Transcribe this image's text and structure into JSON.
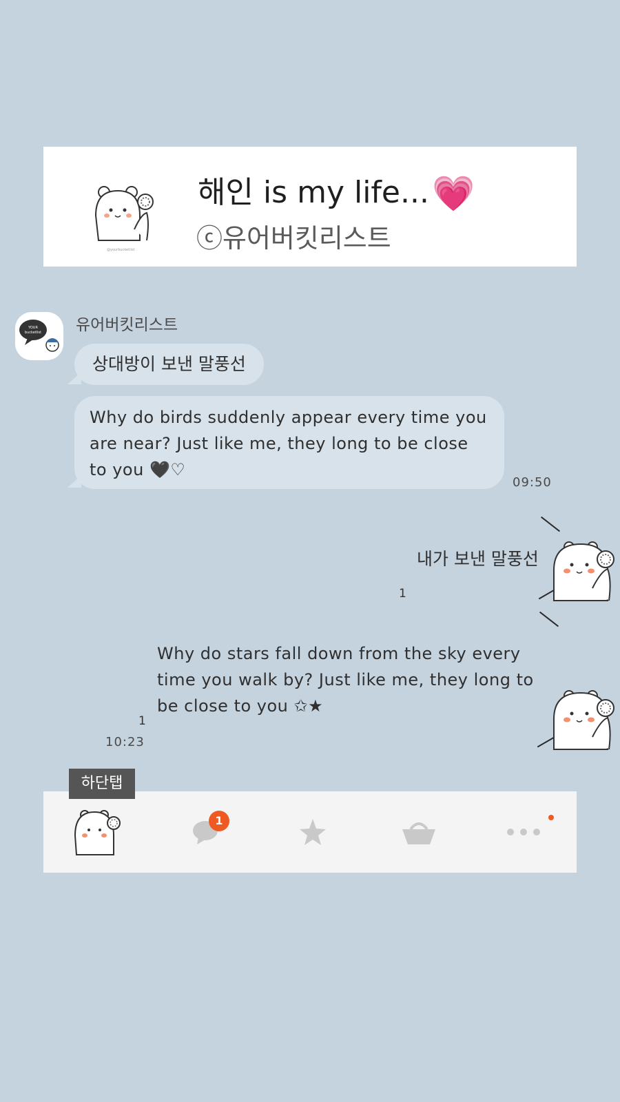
{
  "banner": {
    "title": "해인 is my life...",
    "heart_icon": "💗",
    "subtitle": "ⓒ유어버킷리스트",
    "tiny_credit": "@yourbucketlist"
  },
  "profile": {
    "name": "유어버킷리스트",
    "avatar_text_1": "YOUR",
    "avatar_text_2": "bucketlist"
  },
  "received": {
    "bubble_1": "상대방이 보낸 말풍선",
    "bubble_2": "Why do birds suddenly appear every time you are near? Just like me, they long to be close to you 🖤♡",
    "time": "09:50"
  },
  "sent": {
    "message_1": "내가 보낸 말풍선",
    "read_count_1": "1",
    "message_2": "Why do stars fall down from the sky every time you walk by? Just like me, they long to be close to you ✩★",
    "read_count_2": "1",
    "time": "10:23"
  },
  "bottom_tab": {
    "label": "하단탭",
    "badge_count": "1",
    "icons": [
      "bear-profile-icon",
      "chat-bubble-icon",
      "star-icon",
      "shopping-basket-icon",
      "more-dots-icon"
    ]
  },
  "colors": {
    "background": "#c5d3df",
    "bubble": "#d8e2ea",
    "badge": "#ef5a23",
    "tab_bar": "#f4f4f4",
    "tab_label": "#555555"
  }
}
